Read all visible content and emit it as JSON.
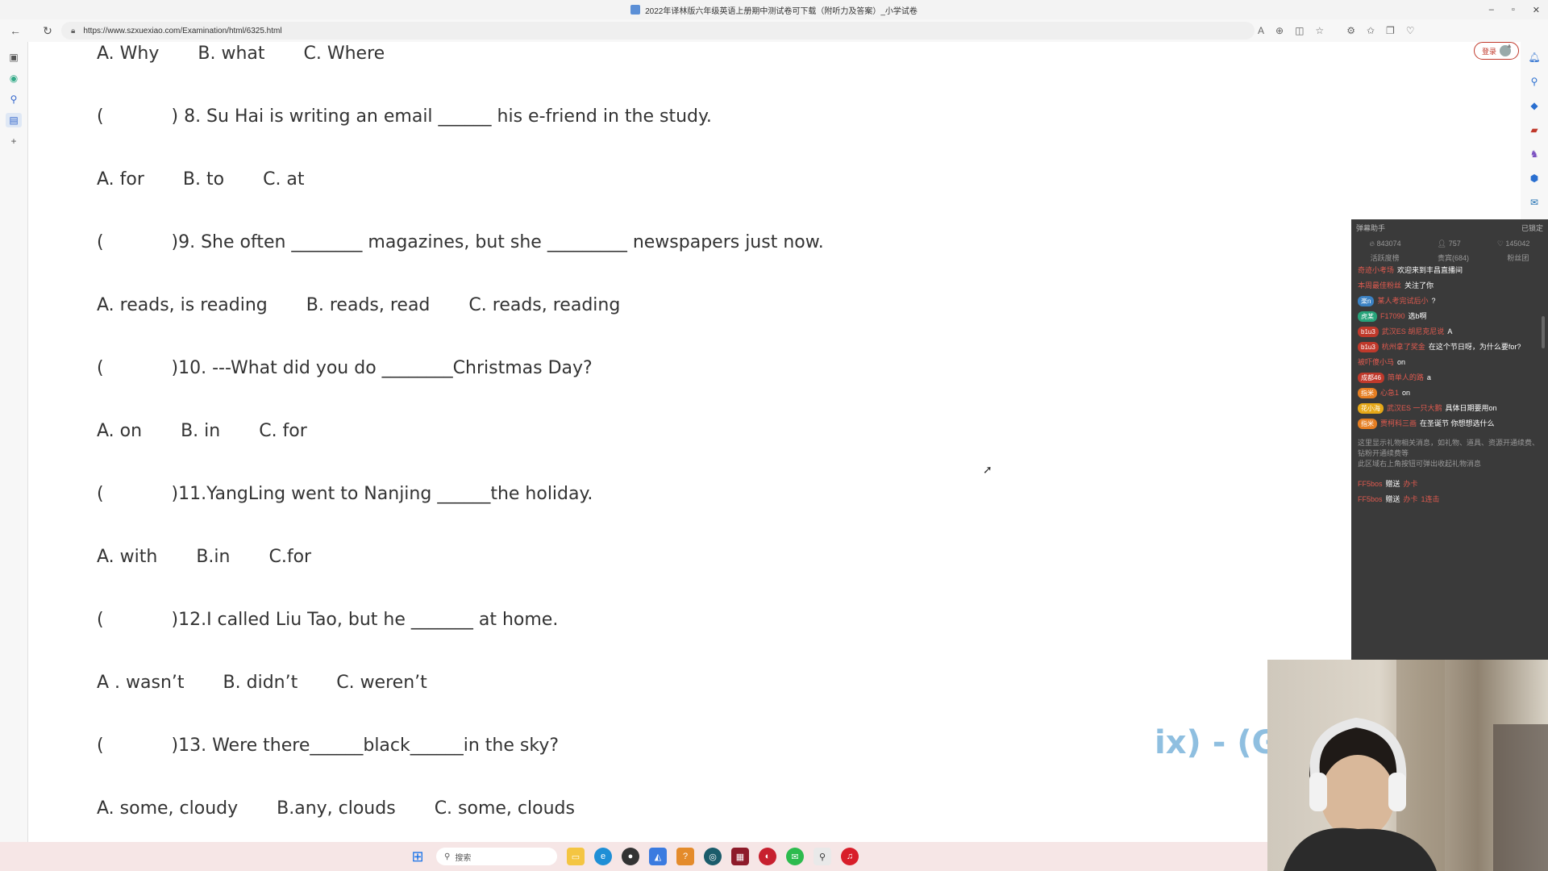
{
  "window": {
    "title": "2022年译林版六年级英语上册期中测试卷可下载（附听力及答案）_小学试卷",
    "controls": [
      "–",
      "▫",
      "✕"
    ]
  },
  "address": {
    "url": "https://www.szxuexiao.com/Examination/html/6325.html",
    "login_label": "登录"
  },
  "quiz": {
    "lines": [
      {
        "kind": "options",
        "items": [
          "A. Why",
          "B. what",
          "C. Where"
        ]
      },
      {
        "kind": "question",
        "text": "(            ) 8. Su Hai is writing an email ______ his e-friend in the study."
      },
      {
        "kind": "options",
        "items": [
          "A. for",
          "B. to",
          "C. at"
        ]
      },
      {
        "kind": "question",
        "text": "(            )9. She often ________ magazines, but she _________ newspapers just now."
      },
      {
        "kind": "options",
        "items": [
          "A. reads, is reading",
          "B. reads, read",
          "C. reads, reading"
        ]
      },
      {
        "kind": "question",
        "text": "(            )10. ---What did you do ________Christmas Day?"
      },
      {
        "kind": "options",
        "items": [
          "A. on",
          "B. in",
          "C. for"
        ]
      },
      {
        "kind": "question",
        "text": "(            )11.YangLing went to Nanjing ______the holiday."
      },
      {
        "kind": "options",
        "items": [
          "A. with",
          "B.in",
          "C.for"
        ]
      },
      {
        "kind": "question",
        "text": "(            )12.I called Liu Tao, but he _______ at home."
      },
      {
        "kind": "options",
        "items": [
          "A . wasn’t",
          "B. didn’t",
          "C. weren’t"
        ]
      },
      {
        "kind": "question",
        "text": "(            )13. Were there______black______in the sky?"
      },
      {
        "kind": "options",
        "items": [
          "A. some, cloudy",
          "B.any, clouds",
          "C. some, clouds"
        ]
      }
    ]
  },
  "chat": {
    "title": "弹幕助手",
    "status": "已锁定",
    "stats": [
      "843074",
      "757",
      "145042"
    ],
    "tabs": [
      "活跃度榜",
      "贵宾(684)",
      "粉丝团"
    ],
    "messages": [
      {
        "badge": "",
        "badge_color": "#c0392b",
        "user": "奇迹小考场",
        "text": "欢迎来到丰昌直播间"
      },
      {
        "badge": "",
        "badge_color": "",
        "user": "本周最佳粉丝",
        "text": "关注了你"
      },
      {
        "badge": "楽n",
        "badge_color": "#3b82c4",
        "user": "某人考完试后小",
        "text": "?"
      },
      {
        "badge": "虎某",
        "badge_color": "#27a37a",
        "user": "F17090",
        "text": "选b啊"
      },
      {
        "badge": "b1u3",
        "badge_color": "#c0392b",
        "user": "武汉ES 胡尼克尼说",
        "text": "A"
      },
      {
        "badge": "b1u3",
        "badge_color": "#c0392b",
        "user": "杭州拿了奖金",
        "text": "在这个节日呀，为什么要for?"
      },
      {
        "badge": "",
        "badge_color": "",
        "user": "被吓傻小马",
        "text": "on"
      },
      {
        "badge": "成都46",
        "badge_color": "#c0392b",
        "user": "简单人的路",
        "text": "a"
      },
      {
        "badge": "指米",
        "badge_color": "#e67e22",
        "user": "心急1",
        "text": "on"
      },
      {
        "badge": "花小海",
        "badge_color": "#e6a817",
        "user": "武汉ES 一只大鹅",
        "text": "具体日期要用on"
      },
      {
        "badge": "指米",
        "badge_color": "#e67e22",
        "user": "贾柯科三画",
        "text": "在圣诞节 你想想选什么"
      }
    ],
    "system_note": "这里显示礼物相关消息，如礼物、道具、资源开通续费、钻粉开通续费等",
    "system_note2": "此区域右上角按钮可弹出收起礼物消息",
    "gifts": [
      {
        "user": "FF5bos",
        "verb": "赠送",
        "item": "办卡",
        "suffix": ""
      },
      {
        "user": "FF5bos",
        "verb": "赠送",
        "item": "办卡",
        "suffix": "1连击"
      }
    ]
  },
  "overlay": {
    "marquee": "ix) - (G"
  },
  "taskbar": {
    "search_placeholder": "搜索"
  }
}
